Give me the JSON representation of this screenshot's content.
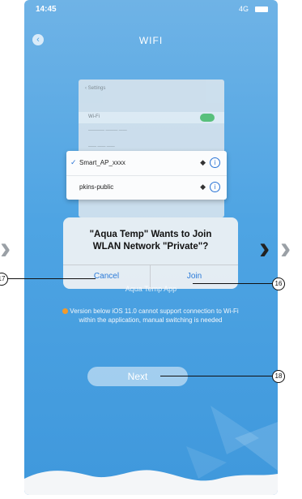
{
  "status_bar": {
    "time": "14:45",
    "signal": "4G"
  },
  "nav": {
    "title": "WIFI"
  },
  "wifi_list": [
    {
      "name": "Smart_AP_xxxx",
      "checked": true
    },
    {
      "name": "pkins-public",
      "checked": false
    }
  ],
  "alert": {
    "line1": "\"Aqua Temp\" Wants to Join",
    "line2": "WLAN Network \"Private\"?",
    "cancel": "Cancel",
    "join": "Join"
  },
  "app_label": "Aqua Temp App",
  "version_note": "Version below iOS 11.0 cannot support connection to Wi-Fi within the application, manual switching is needed",
  "next_label": "Next",
  "callouts": {
    "c17": "17",
    "c16": "16",
    "c18": "18"
  },
  "colors": {
    "accent": "#4ea4e3",
    "alert_link": "#2a7ad8",
    "warning_dot": "#f39a2a"
  },
  "icons": [
    "back-icon",
    "wifi-signal-icon",
    "info-icon",
    "check-icon",
    "chevron-right-icon"
  ]
}
